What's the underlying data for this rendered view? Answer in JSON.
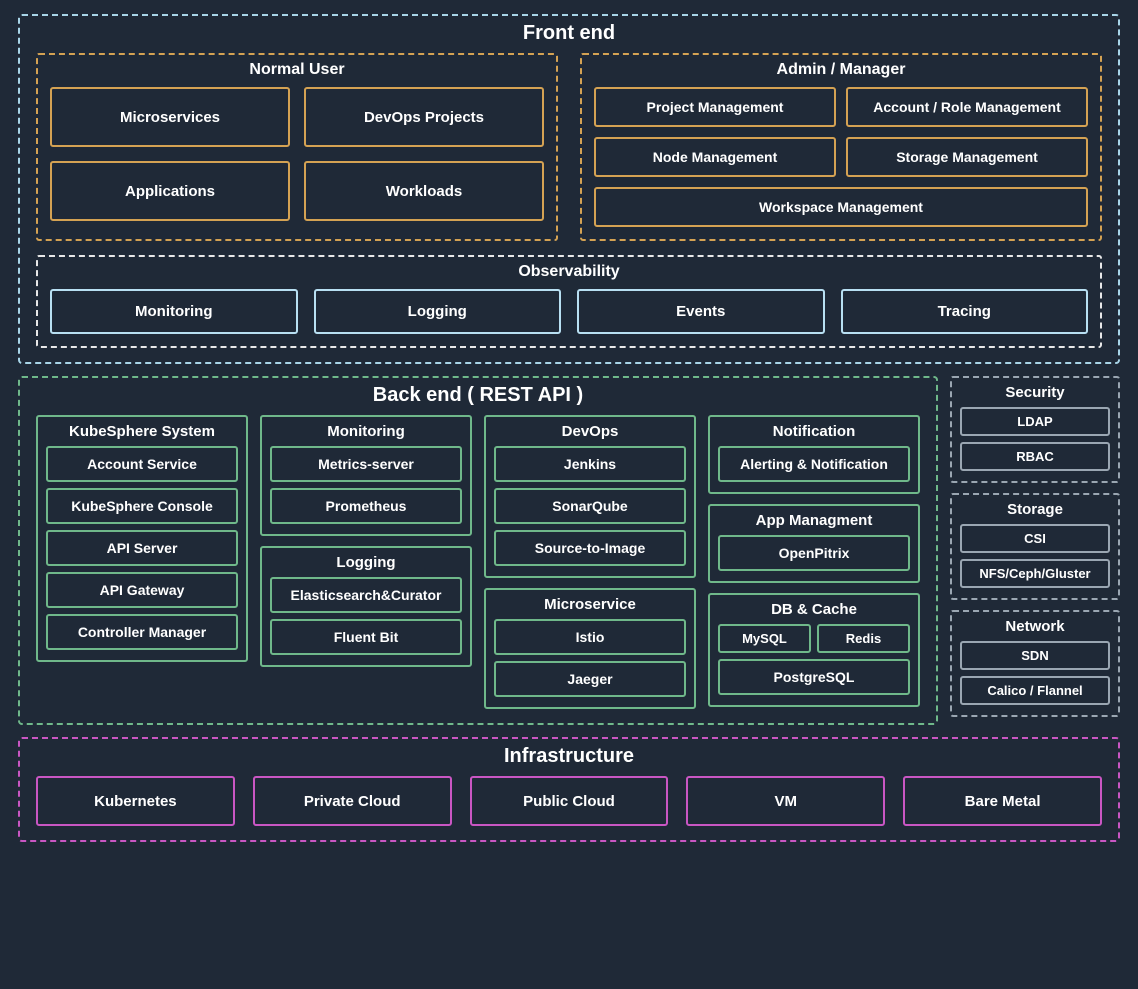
{
  "frontend": {
    "title": "Front end",
    "normal_user": {
      "title": "Normal User",
      "items": [
        "Microservices",
        "DevOps Projects",
        "Applications",
        "Workloads"
      ]
    },
    "admin": {
      "title": "Admin / Manager",
      "items": [
        "Project Management",
        "Account / Role Management",
        "Node Management",
        "Storage Management",
        "Workspace Management"
      ]
    },
    "observability": {
      "title": "Observability",
      "items": [
        "Monitoring",
        "Logging",
        "Events",
        "Tracing"
      ]
    }
  },
  "backend": {
    "title": "Back end ( REST API )",
    "kubesphere": {
      "title": "KubeSphere System",
      "items": [
        "Account Service",
        "KubeSphere Console",
        "API Server",
        "API Gateway",
        "Controller Manager"
      ]
    },
    "monitoring": {
      "title": "Monitoring",
      "items": [
        "Metrics-server",
        "Prometheus"
      ]
    },
    "logging": {
      "title": "Logging",
      "items": [
        "Elasticsearch&Curator",
        "Fluent Bit"
      ]
    },
    "devops": {
      "title": "DevOps",
      "items": [
        "Jenkins",
        "SonarQube",
        "Source-to-Image"
      ]
    },
    "microservice": {
      "title": "Microservice",
      "items": [
        "Istio",
        "Jaeger"
      ]
    },
    "notification": {
      "title": "Notification",
      "items": [
        "Alerting & Notification"
      ]
    },
    "app_mgmt": {
      "title": "App Managment",
      "items": [
        "OpenPitrix"
      ]
    },
    "db_cache": {
      "title": "DB & Cache",
      "row": [
        "MySQL",
        "Redis"
      ],
      "full": [
        "PostgreSQL"
      ]
    }
  },
  "security": {
    "title": "Security",
    "items": [
      "LDAP",
      "RBAC"
    ]
  },
  "storage": {
    "title": "Storage",
    "items": [
      "CSI",
      "NFS/Ceph/Gluster"
    ]
  },
  "network": {
    "title": "Network",
    "items": [
      "SDN",
      "Calico / Flannel"
    ]
  },
  "infrastructure": {
    "title": "Infrastructure",
    "items": [
      "Kubernetes",
      "Private Cloud",
      "Public Cloud",
      "VM",
      "Bare Metal"
    ]
  }
}
